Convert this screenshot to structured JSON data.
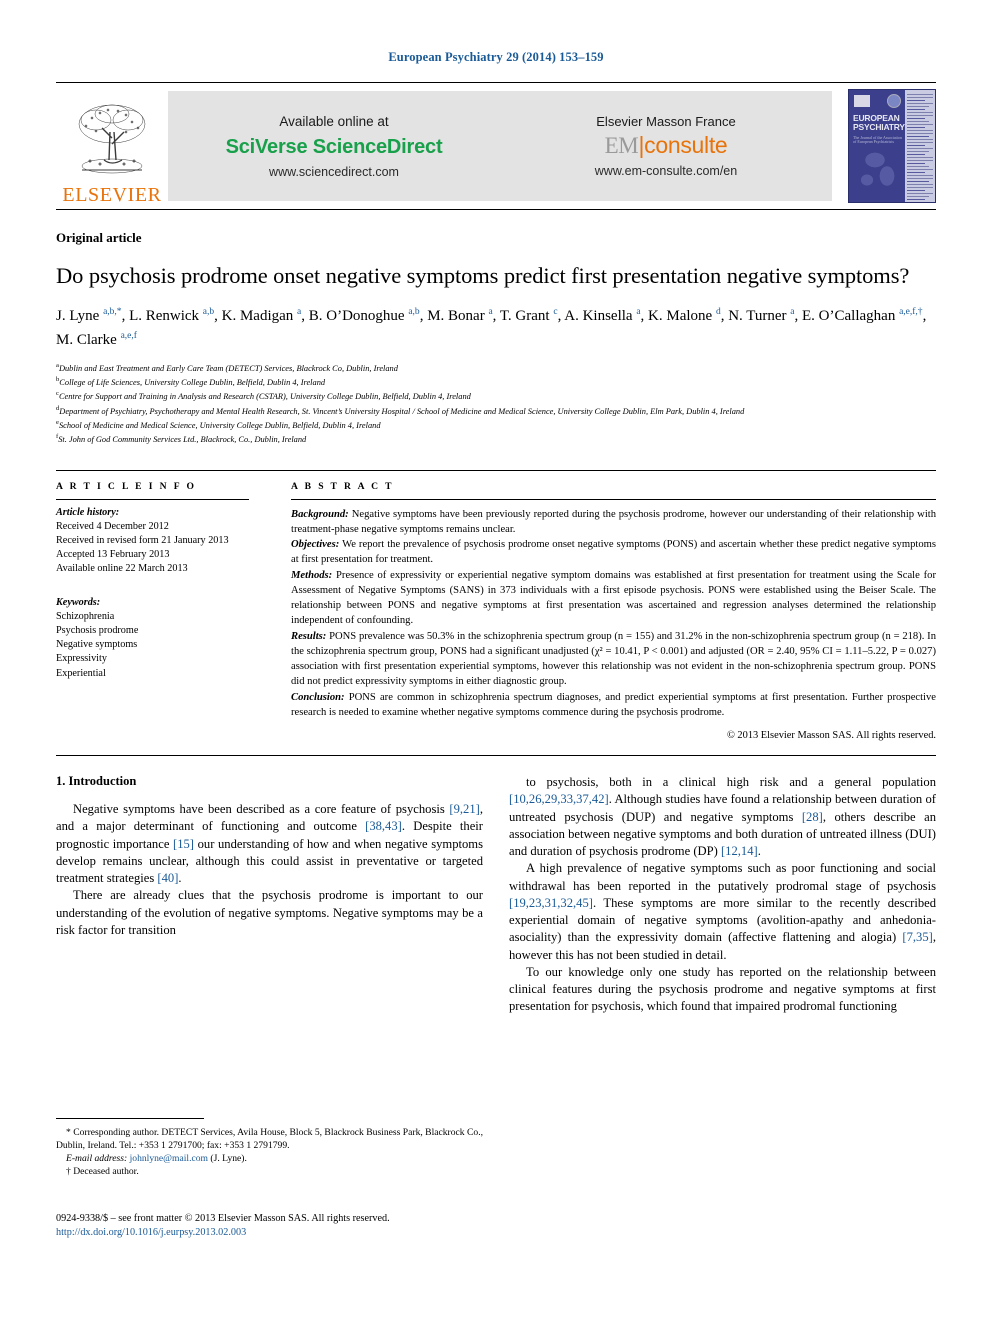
{
  "running_head": "European Psychiatry 29 (2014) 153–159",
  "masthead": {
    "publisher_word": "ELSEVIER",
    "available_online": "Available online at",
    "sciverse": "SciVerse ScienceDirect",
    "sciencedirect_url": "www.sciencedirect.com",
    "masson": "Elsevier Masson France",
    "em": "EM",
    "em_bar": "|",
    "consulte": "consulte",
    "emconsulte_url": "www.em-consulte.com/en",
    "cover_title_line1": "EUROPEAN",
    "cover_title_line2": "PSYCHIATRY",
    "cover_subtitle": "The Journal of the Association of European Psychiatrists"
  },
  "article": {
    "type": "Original article",
    "title": "Do psychosis prodrome onset negative symptoms predict first presentation negative symptoms?",
    "authors_line1": "J. Lyne",
    "authors_html": "J. Lyne <sup>a,b,*</sup>, L. Renwick <sup>a,b</sup>, K. Madigan <sup>a</sup>, B. O’Donoghue <sup>a,b</sup>, M. Bonar <sup>a</sup>, T. Grant <sup>c</sup>, A. Kinsella <sup>a</sup>, K. Malone <sup>d</sup>, N. Turner <sup>a</sup>, E. O’Callaghan <sup>a,e,f,†</sup>, M. Clarke <sup>a,e,f</sup>",
    "affiliations": [
      {
        "mark": "a",
        "text": "Dublin and East Treatment and Early Care Team (DETECT) Services, Blackrock Co, Dublin, Ireland"
      },
      {
        "mark": "b",
        "text": "College of Life Sciences, University College Dublin, Belfield, Dublin 4, Ireland"
      },
      {
        "mark": "c",
        "text": "Centre for Support and Training in Analysis and Research (CSTAR), University College Dublin, Belfield, Dublin 4, Ireland"
      },
      {
        "mark": "d",
        "text": "Department of Psychiatry, Psychotherapy and Mental Health Research, St. Vincent’s University Hospital / School of Medicine and Medical Science, University College Dublin, Elm Park, Dublin 4, Ireland"
      },
      {
        "mark": "e",
        "text": "School of Medicine and Medical Science, University College Dublin, Belfield, Dublin 4, Ireland"
      },
      {
        "mark": "f",
        "text": "St. John of God Community Services Ltd., Blackrock, Co., Dublin, Ireland"
      }
    ]
  },
  "article_info": {
    "heading": "A R T I C L E  I N F O",
    "history_label": "Article history:",
    "history": [
      "Received 4 December 2012",
      "Received in revised form 21 January 2013",
      "Accepted 13 February 2013",
      "Available online 22 March 2013"
    ],
    "keywords_label": "Keywords:",
    "keywords": [
      "Schizophrenia",
      "Psychosis prodrome",
      "Negative symptoms",
      "Expressivity",
      "Experiential"
    ]
  },
  "abstract": {
    "heading": "A B S T R A C T",
    "sections": [
      {
        "label": "Background:",
        "text": " Negative symptoms have been previously reported during the psychosis prodrome, however our understanding of their relationship with treatment-phase negative symptoms remains unclear."
      },
      {
        "label": "Objectives:",
        "text": " We report the prevalence of psychosis prodrome onset negative symptoms (PONS) and ascertain whether these predict negative symptoms at first presentation for treatment."
      },
      {
        "label": "Methods:",
        "text": " Presence of expressivity or experiential negative symptom domains was established at first presentation for treatment using the Scale for Assessment of Negative Symptoms (SANS) in 373 individuals with a first episode psychosis. PONS were established using the Beiser Scale. The relationship between PONS and negative symptoms at first presentation was ascertained and regression analyses determined the relationship independent of confounding."
      },
      {
        "label": "Results:",
        "text": " PONS prevalence was 50.3% in the schizophrenia spectrum group (n = 155) and 31.2% in the non-schizophrenia spectrum group (n = 218). In the schizophrenia spectrum group, PONS had a significant unadjusted (χ² = 10.41, P < 0.001) and adjusted (OR = 2.40, 95% CI = 1.11–5.22, P = 0.027) association with first presentation experiential symptoms, however this relationship was not evident in the non-schizophrenia spectrum group. PONS did not predict expressivity symptoms in either diagnostic group."
      },
      {
        "label": "Conclusion:",
        "text": " PONS are common in schizophrenia spectrum diagnoses, and predict experiential symptoms at first presentation. Further prospective research is needed to examine whether negative symptoms commence during the psychosis prodrome."
      }
    ],
    "copyright": "© 2013 Elsevier Masson SAS. All rights reserved."
  },
  "body": {
    "section_heading": "1. Introduction",
    "left_paragraphs": [
      "Negative symptoms have been described as a core feature of psychosis [9,21], and a major determinant of functioning and outcome [38,43]. Despite their prognostic importance [15] our understanding of how and when negative symptoms develop remains unclear, although this could assist in preventative or targeted treatment strategies [40].",
      "There are already clues that the psychosis prodrome is important to our understanding of the evolution of negative symptoms. Negative symptoms may be a risk factor for transition"
    ],
    "right_paragraphs": [
      "to psychosis, both in a clinical high risk and a general population [10,26,29,33,37,42]. Although studies have found a relationship between duration of untreated psychosis (DUP) and negative symptoms [28], others describe an association between negative symptoms and both duration of untreated illness (DUI) and duration of psychosis prodrome (DP) [12,14].",
      "A high prevalence of negative symptoms such as poor functioning and social withdrawal has been reported in the putatively prodromal stage of psychosis [19,23,31,32,45]. These symptoms are more similar to the recently described experiential domain of negative symptoms (avolition-apathy and anhedonia-asociality) than the expressivity domain (affective flattening and alogia) [7,35], however this has not been studied in detail.",
      "To our knowledge only one study has reported on the relationship between clinical features during the psychosis prodrome and negative symptoms at first presentation for psychosis, which found that impaired prodromal functioning"
    ]
  },
  "footnotes": {
    "corresponding": "* Corresponding author. DETECT Services, Avila House, Block 5, Blackrock Business Park, Blackrock Co., Dublin, Ireland. Tel.: +353 1 2791700; fax: +353 1 2791799.",
    "email_label": "E-mail address:",
    "email": "johnlyne@mail.com",
    "email_suffix": " (J. Lyne).",
    "deceased": "† Deceased author."
  },
  "imprint": {
    "line1": "0924-9338/$ – see front matter © 2013 Elsevier Masson SAS. All rights reserved.",
    "doi": "http://dx.doi.org/10.1016/j.eurpsy.2013.02.003"
  },
  "colors": {
    "link": "#1a5a96",
    "elsevier_orange": "#E8730A",
    "sciencedirect_green": "#18a04a",
    "cover_blue": "#3b3f8c"
  }
}
